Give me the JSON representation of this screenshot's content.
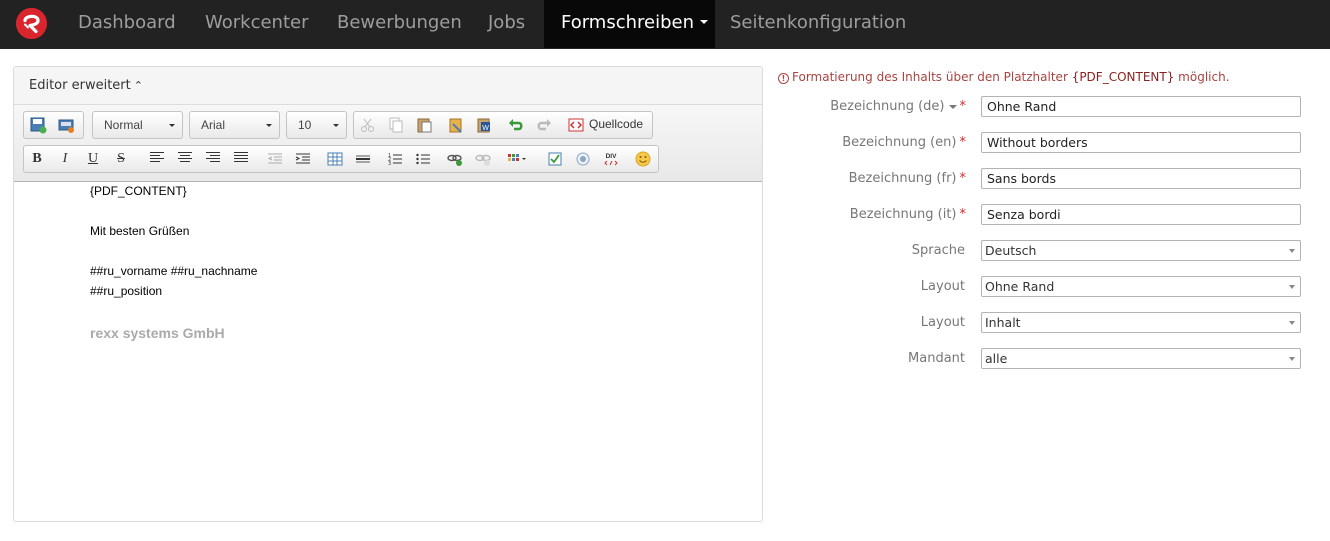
{
  "nav": {
    "logo_icon": "rexx-logo-icon",
    "items": [
      {
        "label": "Dashboard"
      },
      {
        "label": "Workcenter"
      },
      {
        "label": "Bewerbungen"
      },
      {
        "label": "Jobs"
      },
      {
        "label": "Formschreiben"
      },
      {
        "label": "Seitenkonfiguration"
      }
    ],
    "active_index": 4
  },
  "editor": {
    "title": "Editor erweitert",
    "collapse_icon": "double-chevron-up-icon",
    "toolbar": {
      "format_value": "Normal",
      "font_value": "Arial",
      "size_value": "10",
      "source_label": "Quellcode",
      "bold_glyph": "B",
      "italic_glyph": "I",
      "underline_glyph": "U",
      "strike_glyph": "S"
    },
    "content": {
      "placeholder": "{PDF_CONTENT}",
      "greeting": "Mit besten Grüßen",
      "name_line": "##ru_vorname ##ru_nachname",
      "position_line": "##ru_position",
      "company": "rexx systems GmbH"
    }
  },
  "form": {
    "info_prefix": "Formatierung des Inhalts über den Platzhalter ",
    "info_placeholder": "{PDF_CONTENT}",
    "info_suffix": " möglich.",
    "required_mark": "*",
    "fields": {
      "name_de": {
        "label": "Bezeichnung (de)",
        "value": "Ohne Rand"
      },
      "name_en": {
        "label": "Bezeichnung (en)",
        "value": "Without borders"
      },
      "name_fr": {
        "label": "Bezeichnung (fr)",
        "value": "Sans bords"
      },
      "name_it": {
        "label": "Bezeichnung (it)",
        "value": "Senza bordi"
      },
      "language": {
        "label": "Sprache",
        "value": "Deutsch"
      },
      "layout1": {
        "label": "Layout",
        "value": "Ohne Rand"
      },
      "layout2": {
        "label": "Layout",
        "value": "Inhalt"
      },
      "client": {
        "label": "Mandant",
        "value": "alle"
      }
    }
  },
  "colors": {
    "navbar": "#222222",
    "nav_active": "#080808",
    "accent_red": "#d9252e",
    "info_text": "#a94442"
  }
}
